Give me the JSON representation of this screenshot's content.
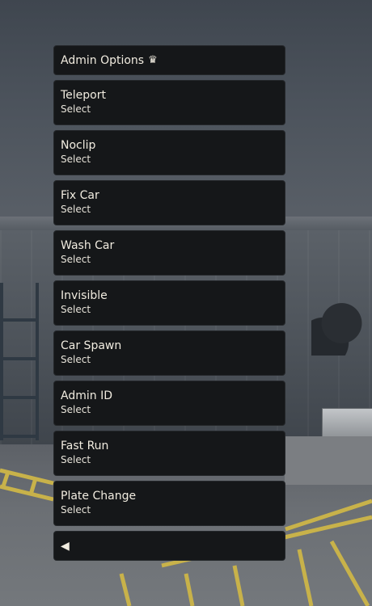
{
  "menu": {
    "header": {
      "title": "Admin Options",
      "icon": "crown-icon",
      "icon_glyph": "♛"
    },
    "items": [
      {
        "title": "Teleport",
        "subtitle": "Select"
      },
      {
        "title": "Noclip",
        "subtitle": "Select"
      },
      {
        "title": "Fix Car",
        "subtitle": "Select"
      },
      {
        "title": "Wash Car",
        "subtitle": "Select"
      },
      {
        "title": "Invisible",
        "subtitle": "Select"
      },
      {
        "title": "Car Spawn",
        "subtitle": "Select"
      },
      {
        "title": "Admin ID",
        "subtitle": "Select"
      },
      {
        "title": "Fast Run",
        "subtitle": "Select"
      },
      {
        "title": "Plate Change",
        "subtitle": "Select"
      }
    ],
    "back": {
      "icon": "back-arrow-icon",
      "icon_glyph": "◀"
    }
  },
  "colors": {
    "panel": "#151719",
    "text": "#f1ece0",
    "floor_lines": "#c8b24a"
  }
}
